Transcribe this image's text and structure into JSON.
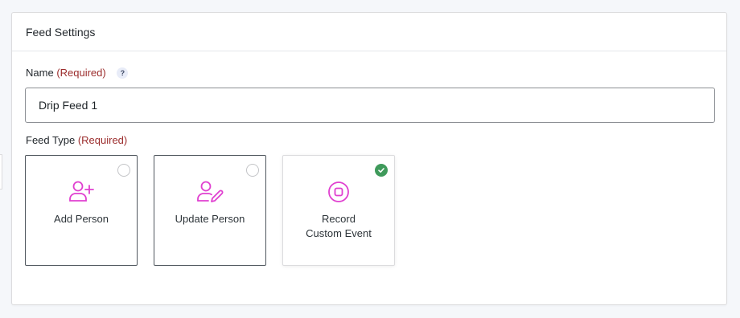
{
  "panel": {
    "title": "Feed Settings"
  },
  "name_field": {
    "label": "Name",
    "required": "(Required)",
    "help": "?",
    "value": "Drip Feed 1"
  },
  "feed_type": {
    "label": "Feed Type",
    "required": "(Required)",
    "options": [
      {
        "label": "Add Person",
        "icon": "add-person-icon",
        "selected": false
      },
      {
        "label": "Update Person",
        "icon": "edit-person-icon",
        "selected": false
      },
      {
        "label": "Record\nCustom Event",
        "icon": "record-event-icon",
        "selected": true
      }
    ]
  },
  "colors": {
    "accent": "#e040d0",
    "required": "#9b2c2c",
    "selected": "#3f9a5b"
  }
}
